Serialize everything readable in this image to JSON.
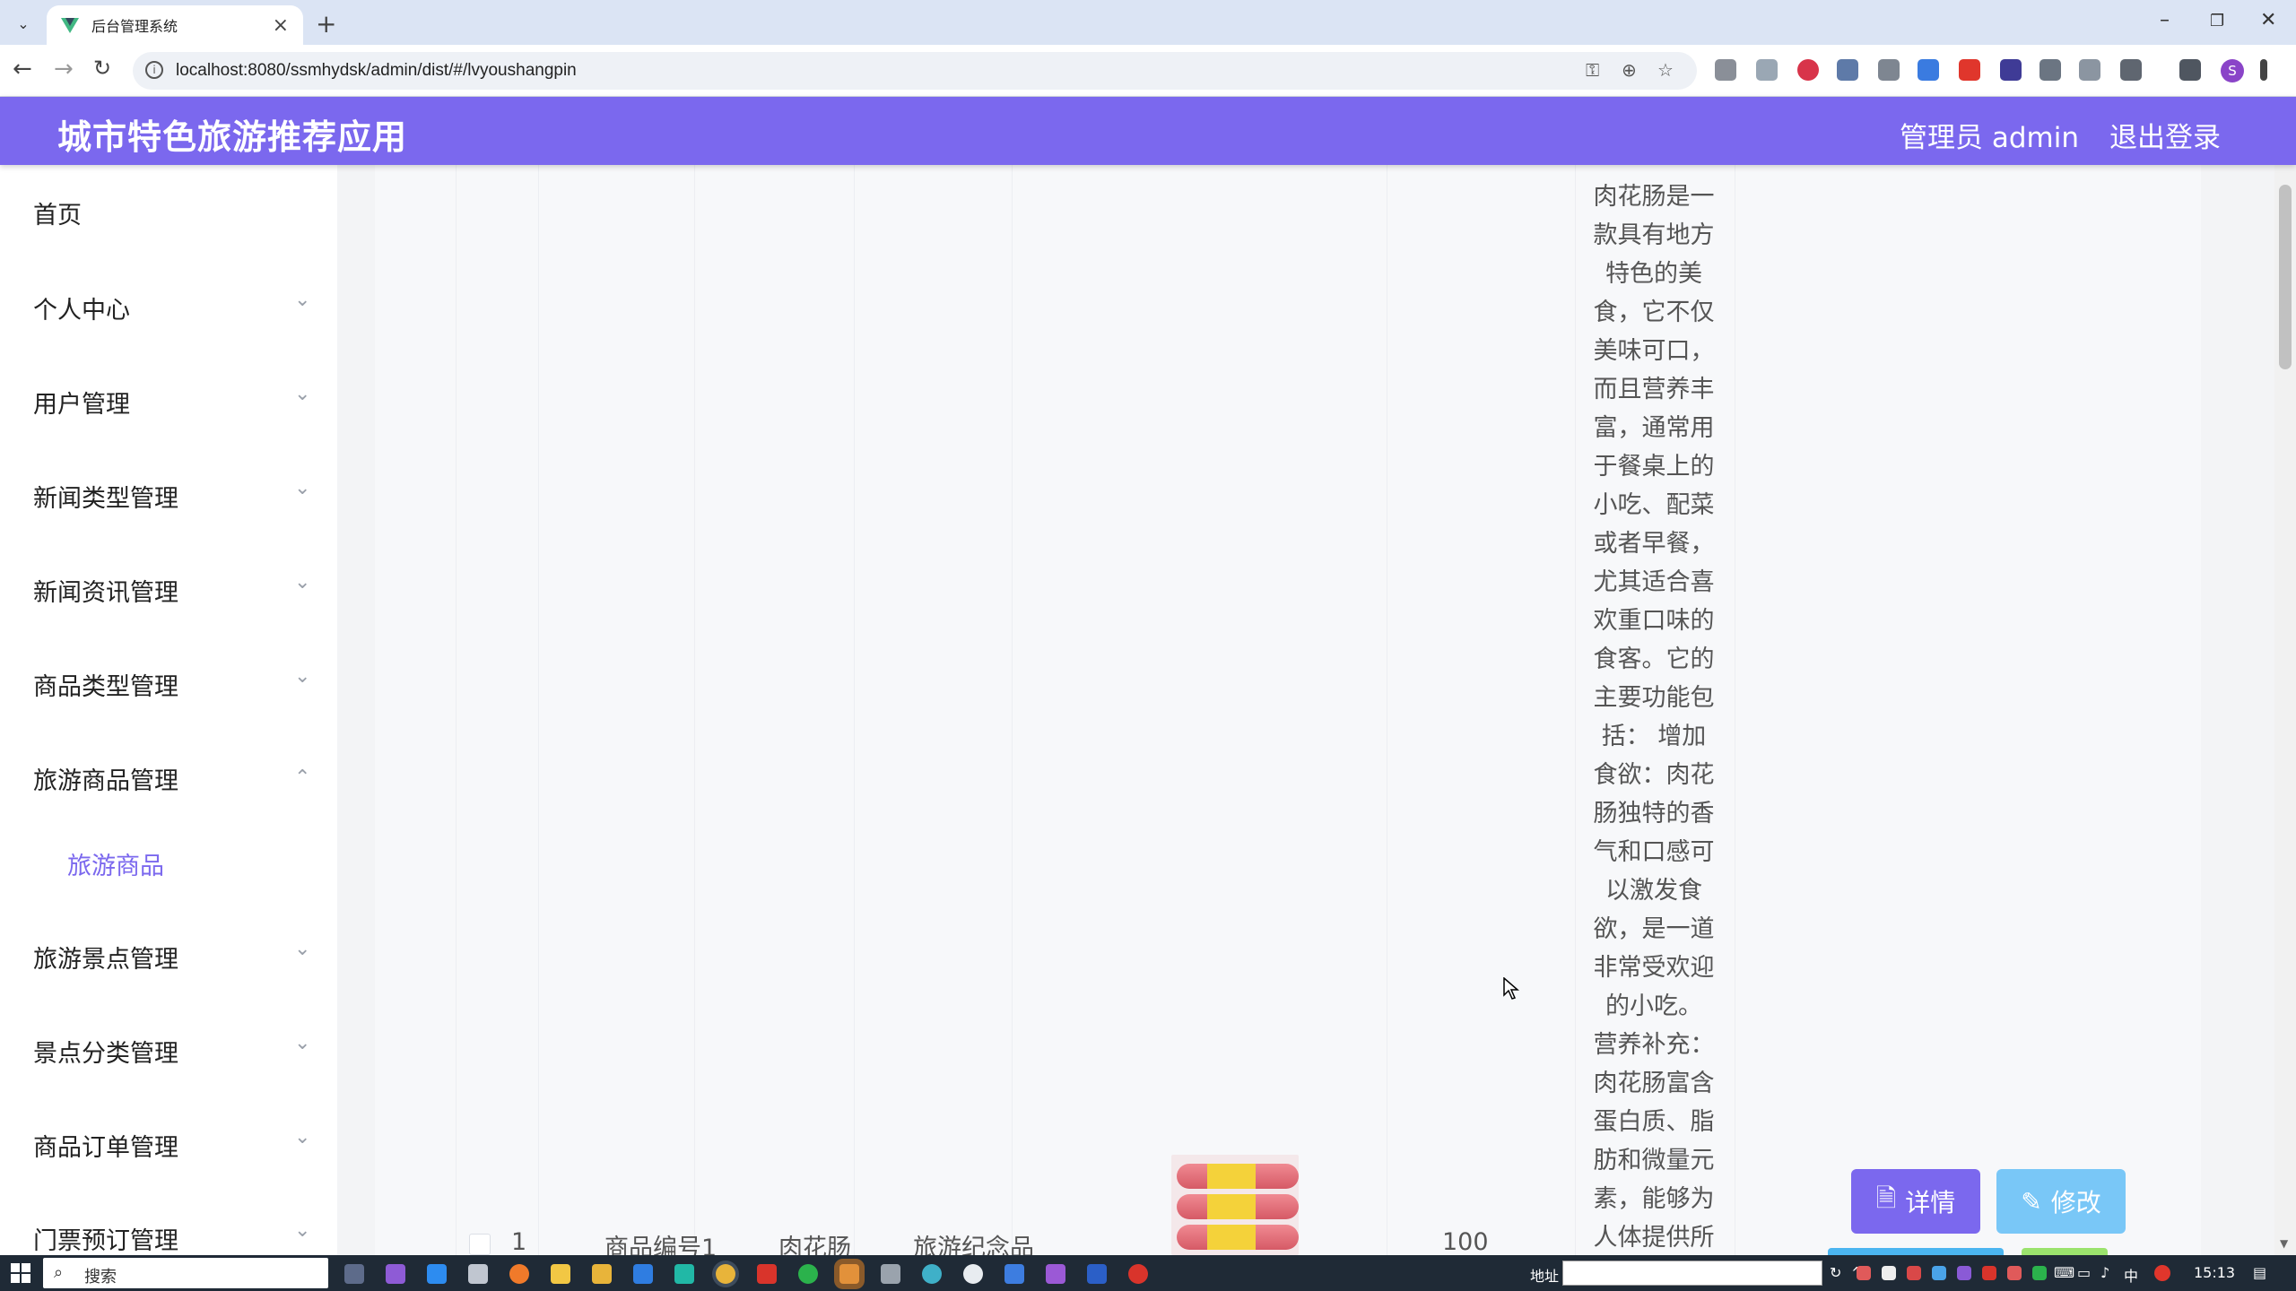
{
  "browser": {
    "tab_title": "后台管理系统",
    "url": "localhost:8080/ssmhydsk/admin/dist/#/lvyoushangpin"
  },
  "header": {
    "title": "城市特色旅游推荐应用",
    "admin_label": "管理员 admin",
    "logout_label": "退出登录"
  },
  "sidebar": {
    "items": [
      {
        "label": "首页"
      },
      {
        "label": "个人中心"
      },
      {
        "label": "用户管理"
      },
      {
        "label": "新闻类型管理"
      },
      {
        "label": "新闻资讯管理"
      },
      {
        "label": "商品类型管理"
      },
      {
        "label": "旅游商品管理"
      },
      {
        "label": "旅游商品"
      },
      {
        "label": "旅游景点管理"
      },
      {
        "label": "景点分类管理"
      },
      {
        "label": "商品订单管理"
      },
      {
        "label": "门票预订管理"
      }
    ]
  },
  "table": {
    "row": {
      "index": "1",
      "code": "商品编号1",
      "name": "肉花肠",
      "category": "旅游纪念品",
      "value": "100",
      "description": "肉花肠是一款具有地方特色的美食，它不仅美味可口，而且营养丰富，通常用于餐桌上的小吃、配菜或者早餐，尤其适合喜欢重口味的食客。它的主要功能包括： 增加食欲：肉花肠独特的香气和口感可以激发食欲，是一道非常受欢迎的小吃。 营养补充：肉花肠富含蛋白质、脂肪和微量元素，能够为人体提供所"
    },
    "actions": {
      "detail_label": "详情",
      "edit_label": "修改"
    }
  },
  "taskbar": {
    "search_label": "搜索",
    "address_label": "地址",
    "ime_label": "中",
    "time": "15:13"
  },
  "colors": {
    "accent": "#7b68ee",
    "edit_button": "#79c7f7"
  }
}
